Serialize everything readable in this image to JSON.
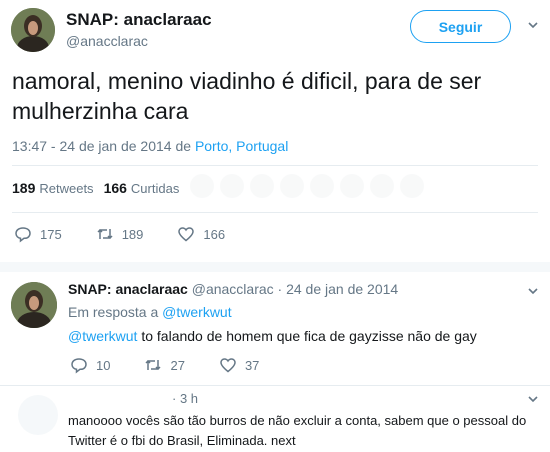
{
  "main_tweet": {
    "display_name": "SNAP: anaclaraac",
    "handle": "@anacclarac",
    "follow_label": "Seguir",
    "text": "namoral, menino viadinho é dificil, para de ser mulherzinha cara",
    "timestamp": "13:47 - 24 de jan de 2014 de ",
    "location": "Porto, Portugal",
    "retweets_count": "189",
    "retweets_label": "Retweets",
    "likes_count": "166",
    "likes_label": "Curtidas",
    "action_reply_count": "175",
    "action_retweet_count": "189",
    "action_like_count": "166"
  },
  "reply_tweet": {
    "display_name": "SNAP: anaclaraac",
    "handle_time": "@anacclarac · 24 de jan de 2014",
    "reply_prefix": "Em resposta a ",
    "reply_to": "@twerkwut",
    "mention": "@twerkwut",
    "text": " to falando de homem que fica de gayzisse não de gay",
    "reply_count": "10",
    "retweet_count": "27",
    "like_count": "37"
  },
  "third_tweet": {
    "time": "· 3 h",
    "text": "manoooo vocês são tão burros de não excluir a conta, sabem que o pessoal do Twitter é o fbi do Brasil, Eliminada. next"
  },
  "colors": {
    "accent": "#1da1f2",
    "muted": "#657786",
    "text": "#14171a",
    "divider": "#e6ecf0"
  }
}
